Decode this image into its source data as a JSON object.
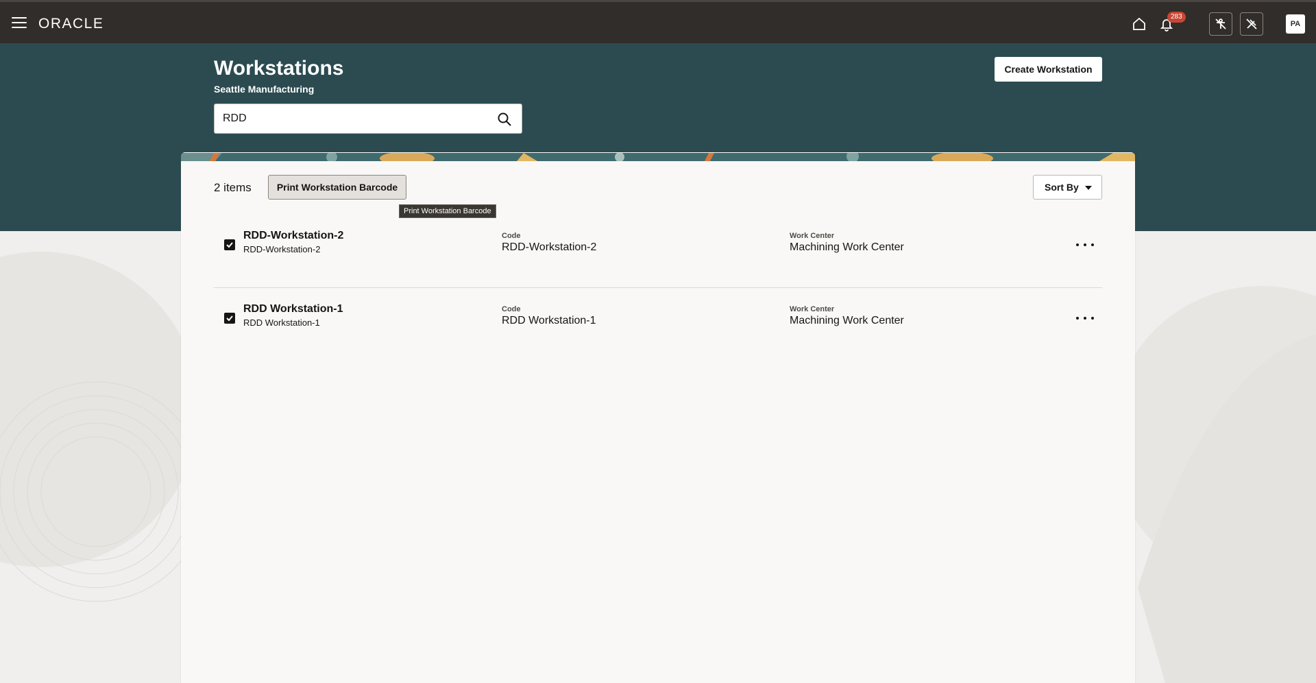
{
  "app": {
    "logo_text": "ORACLE",
    "notification_count": "283",
    "user_initials": "PA"
  },
  "header": {
    "title": "Workstations",
    "subtitle": "Seattle Manufacturing",
    "create_button_label": "Create Workstation"
  },
  "search": {
    "value": "RDD"
  },
  "toolbar": {
    "item_count": "2 items",
    "print_button_label": "Print Workstation Barcode",
    "tooltip": "Print Workstation Barcode",
    "sort_label": "Sort By"
  },
  "list": {
    "code_label": "Code",
    "work_center_label": "Work Center",
    "items": [
      {
        "name": "RDD-Workstation-2",
        "subtitle": "RDD-Workstation-2",
        "code": "RDD-Workstation-2",
        "work_center": "Machining Work Center",
        "checked": true
      },
      {
        "name": "RDD Workstation-1",
        "subtitle": "RDD Workstation-1",
        "code": "RDD Workstation-1",
        "work_center": "Machining Work Center",
        "checked": true
      }
    ]
  },
  "colors": {
    "topbar": "#312d2a",
    "header_band": "#2b4b51",
    "badge": "#c74634"
  }
}
